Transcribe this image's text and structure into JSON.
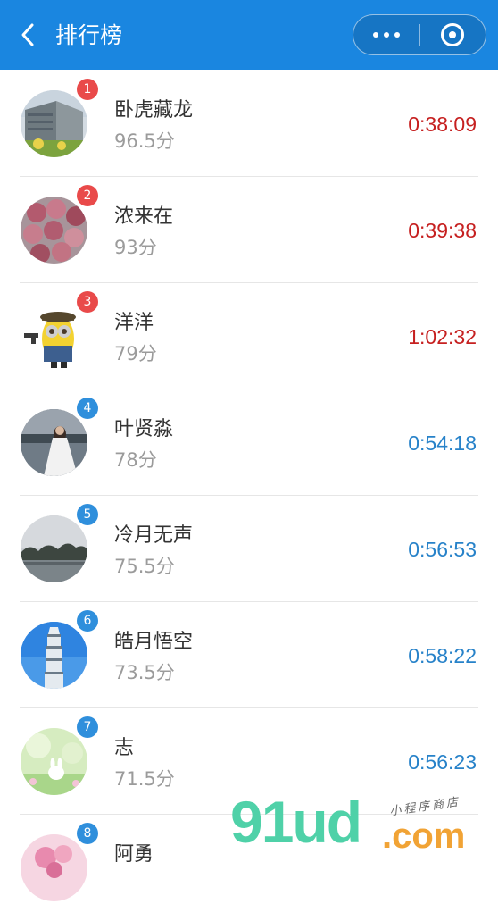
{
  "header": {
    "title": "排行榜"
  },
  "colors": {
    "navbar": "#1a86e0",
    "top_rank": "#c62020",
    "other_rank": "#2782c9"
  },
  "ranking": [
    {
      "rank": "1",
      "name": "卧虎藏龙",
      "score": "96.5分",
      "time": "0:38:09",
      "avatar": "building-photo"
    },
    {
      "rank": "2",
      "name": "浓来在",
      "score": "93分",
      "time": "0:39:38",
      "avatar": "fruit-photo"
    },
    {
      "rank": "3",
      "name": "洋洋",
      "score": "79分",
      "time": "1:02:32",
      "avatar": "minion-cartoon"
    },
    {
      "rank": "4",
      "name": "叶贤淼",
      "score": "78分",
      "time": "0:54:18",
      "avatar": "bride-photo"
    },
    {
      "rank": "5",
      "name": "冷月无声",
      "score": "75.5分",
      "time": "0:56:53",
      "avatar": "lake-landscape"
    },
    {
      "rank": "6",
      "name": "皓月悟空",
      "score": "73.5分",
      "time": "0:58:22",
      "avatar": "pagoda-photo"
    },
    {
      "rank": "7",
      "name": "志",
      "score": "71.5分",
      "time": "0:56:23",
      "avatar": "bunny-cartoon"
    },
    {
      "rank": "8",
      "name": "阿勇",
      "score": "",
      "time": "",
      "avatar": "pink-flower"
    }
  ],
  "watermark": {
    "main": "91ud",
    "domain": ".com",
    "tagline": "小程序商店"
  }
}
